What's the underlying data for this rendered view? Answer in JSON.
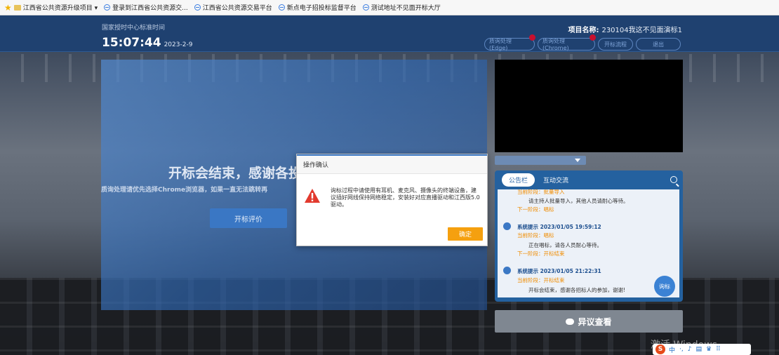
{
  "bookmarks": [
    "江西省公共资源升级项目 ▾",
    "登录到江西省公共资源交...",
    "江西省公共资源交易平台",
    "新点电子招投标监督平台",
    "测试地址不见面开标大厅"
  ],
  "header": {
    "org_label": "国家授时中心标准时间",
    "time": "15:07:44",
    "date": "2023-2-9",
    "project_label": "项目名称:",
    "project_name": "230104我这不见面演标1",
    "buttons": [
      "质询处理(Edge)",
      "质询处理(Chrome)",
      "开标流程",
      "退出"
    ]
  },
  "stage": {
    "title": "开标会结束，感谢各投",
    "notice": "质询处理请优先选择Chrome浏览器，如果一直无法跳转再",
    "eval_button": "开标评价"
  },
  "board": {
    "tabs": [
      "公告栏",
      "互动交流"
    ],
    "entries": [
      {
        "stage_prev": "当前阶段：批量导入",
        "text": "请主持人批量导入，其他人员请耐心等待。",
        "next": "下一阶段：唱标"
      },
      {
        "title": "系统提示 2023/01/05 19:59:12",
        "stage": "当前阶段：唱标",
        "text": "正在唱标，请各人员耐心等待。",
        "next": "下一阶段：开标结束"
      },
      {
        "title": "系统提示 2023/01/05 21:22:31",
        "stage": "当前阶段：开标结束",
        "text": "开标会结束，感谢各招标人的参加，谢谢!"
      }
    ],
    "query_button": "询标"
  },
  "dispute_button": "异议查看",
  "dialog": {
    "title": "操作确认",
    "message": "询标过程中请使用有耳机、麦克风、摄像头的终端设备，建议插好网线保持网络稳定，安装好对应直播驱动和江西版5.0驱动。",
    "ok": "确定"
  },
  "watermark": "激活 Windows",
  "tray": [
    "中",
    "·,",
    "♪",
    "▤",
    "♛",
    "⠿"
  ]
}
